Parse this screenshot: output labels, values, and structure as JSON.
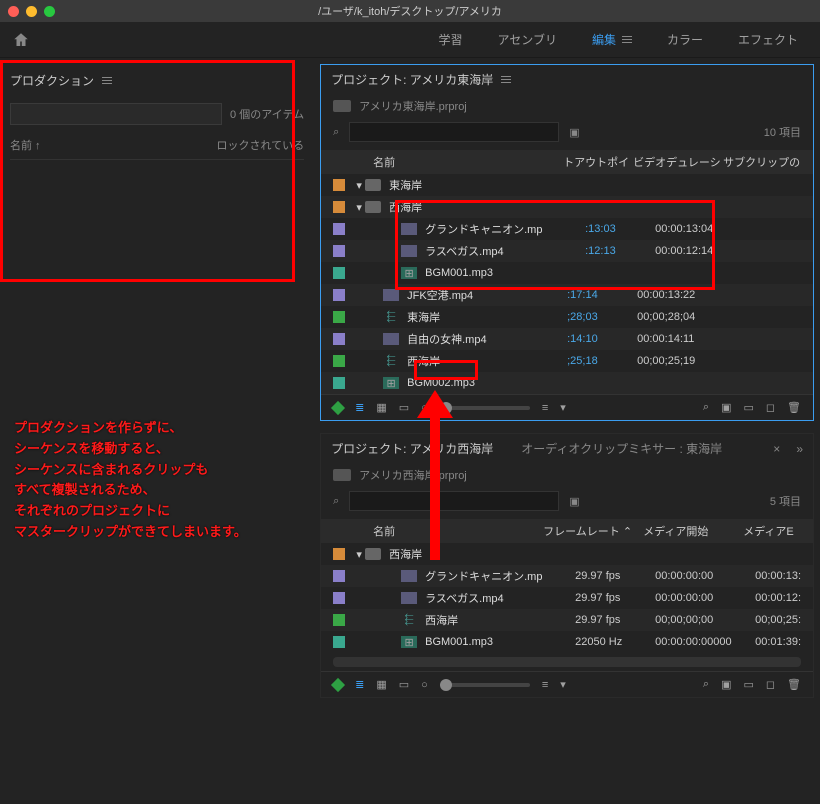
{
  "title_path": "/ユーザ/k_itoh/デスクトップ/アメリカ",
  "tabs": {
    "learn": "学習",
    "assembly": "アセンブリ",
    "edit": "編集",
    "color": "カラー",
    "effect": "エフェクト"
  },
  "left": {
    "title": "プロダクション",
    "search_placeholder": "",
    "count": "0 個のアイテム",
    "col_name": "名前 ↑",
    "col_lock": "ロックされている"
  },
  "panel1": {
    "title": "プロジェクト: アメリカ東海岸",
    "file": "アメリカ東海岸.prproj",
    "count": "10 項目",
    "cols": {
      "name": "名前",
      "out": "トアウトポイ",
      "dur": "ビデオデュレーシ",
      "sub": "サブクリップの"
    },
    "rows": [
      {
        "chip": "orange",
        "indent": 0,
        "arrow": "▾",
        "type": "folder",
        "name": "東海岸",
        "out": "",
        "dur": ""
      },
      {
        "chip": "orange",
        "indent": 0,
        "arrow": "▾",
        "type": "folder",
        "name": "西海岸",
        "out": "",
        "dur": ""
      },
      {
        "chip": "purple",
        "indent": 2,
        "arrow": "",
        "type": "clip",
        "name": "グランドキャニオン.mp",
        "out": ":13:03",
        "dur": "00:00:13:04"
      },
      {
        "chip": "purple",
        "indent": 2,
        "arrow": "",
        "type": "clip",
        "name": "ラスベガス.mp4",
        "out": ":12:13",
        "dur": "00:00:12:14"
      },
      {
        "chip": "teal",
        "indent": 2,
        "arrow": "",
        "type": "audio",
        "name": "BGM001.mp3",
        "out": "",
        "dur": ""
      },
      {
        "chip": "purple",
        "indent": 1,
        "arrow": "",
        "type": "clip",
        "name": "JFK空港.mp4",
        "out": ":17:14",
        "dur": "00:00:13:22"
      },
      {
        "chip": "green",
        "indent": 1,
        "arrow": "",
        "type": "seq",
        "name": "東海岸",
        "out": ";28;03",
        "dur": "00;00;28;04"
      },
      {
        "chip": "purple",
        "indent": 1,
        "arrow": "",
        "type": "clip",
        "name": "自由の女神.mp4",
        "out": ":14:10",
        "dur": "00:00:14:11"
      },
      {
        "chip": "green",
        "indent": 1,
        "arrow": "",
        "type": "seq",
        "name": "西海岸",
        "out": ";25;18",
        "dur": "00;00;25;19"
      },
      {
        "chip": "teal",
        "indent": 1,
        "arrow": "",
        "type": "audio",
        "name": "BGM002.mp3",
        "out": "",
        "dur": ""
      }
    ]
  },
  "panel2": {
    "tab1": "プロジェクト: アメリカ西海岸",
    "tab2": "オーディオクリップミキサー : 東海岸",
    "file": "アメリカ西海岸.prproj",
    "count": "5 項目",
    "cols": {
      "name": "名前",
      "fr": "フレームレート ⌃",
      "ms": "メディア開始",
      "me": "メディアE"
    },
    "rows": [
      {
        "chip": "orange",
        "indent": 0,
        "arrow": "▾",
        "type": "folder",
        "name": "西海岸",
        "fr": "",
        "ms": "",
        "me": ""
      },
      {
        "chip": "purple",
        "indent": 2,
        "arrow": "",
        "type": "clip",
        "name": "グランドキャニオン.mp",
        "fr": "29.97 fps",
        "ms": "00:00:00:00",
        "me": "00:00:13:"
      },
      {
        "chip": "purple",
        "indent": 2,
        "arrow": "",
        "type": "clip",
        "name": "ラスベガス.mp4",
        "fr": "29.97 fps",
        "ms": "00:00:00:00",
        "me": "00:00:12:"
      },
      {
        "chip": "green",
        "indent": 2,
        "arrow": "",
        "type": "seq",
        "name": "西海岸",
        "fr": "29.97 fps",
        "ms": "00;00;00;00",
        "me": "00;00;25:"
      },
      {
        "chip": "teal",
        "indent": 2,
        "arrow": "",
        "type": "audio",
        "name": "BGM001.mp3",
        "fr": "22050 Hz",
        "ms": "00:00:00:00000",
        "me": "00:01:39:"
      }
    ]
  },
  "annotation": "プロダクションを作らずに、\nシーケンスを移動すると、\nシーケンスに含まれるクリップも\nすべて複製されるため、\nそれぞれのプロジェクトに\nマスタークリップができてしまいます。"
}
